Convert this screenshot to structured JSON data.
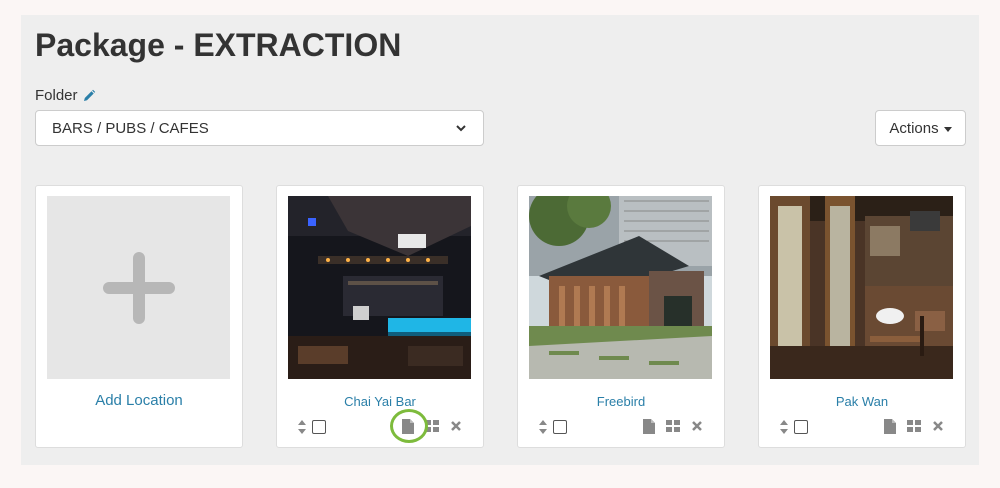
{
  "page": {
    "title": "Package - EXTRACTION",
    "folder_label": "Folder",
    "folder_value": "BARS / PUBS / CAFES",
    "actions_label": "Actions"
  },
  "add_card": {
    "label": "Add Location"
  },
  "locations": [
    {
      "name": "Chai Yai Bar",
      "highlighted_icon": "file-icon"
    },
    {
      "name": "Freebird"
    },
    {
      "name": "Pak Wan"
    }
  ],
  "icons": {
    "edit": "pencil-icon",
    "sort": "sort-icon",
    "file": "file-icon",
    "grid": "grid-icon",
    "remove": "close-icon",
    "add": "plus-icon"
  },
  "colors": {
    "link": "#2a7fa8",
    "highlight": "#7dbb3c",
    "panel": "#eeeeee"
  }
}
